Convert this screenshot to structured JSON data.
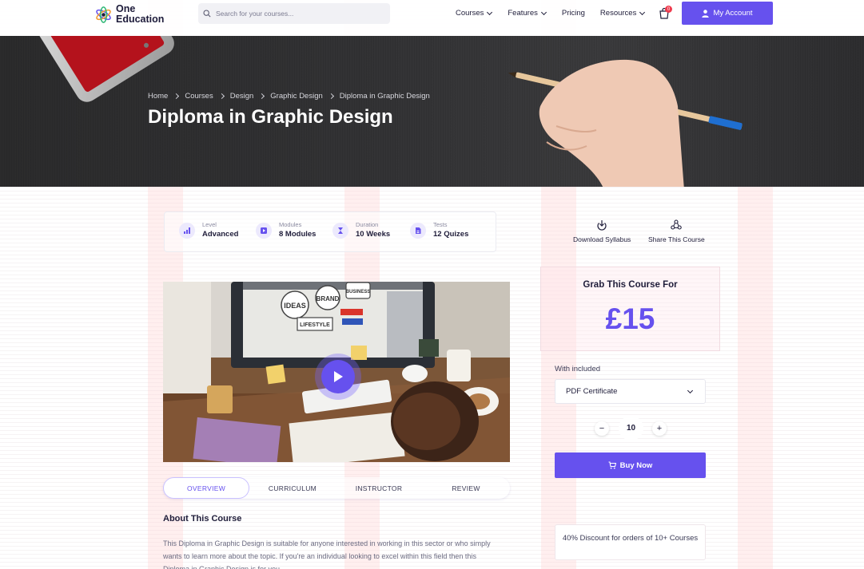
{
  "header": {
    "logo_line1": "One",
    "logo_line2": "Education",
    "search_placeholder": "Search for your courses...",
    "nav": [
      "Courses",
      "Features",
      "Pricing",
      "Resources"
    ],
    "cart_count": "0",
    "account_label": "My Account"
  },
  "hero": {
    "breadcrumb": [
      "Home",
      "Courses",
      "Design",
      "Graphic Design",
      "Diploma in Graphic Design"
    ],
    "title": "Diploma in Graphic Design"
  },
  "stats": [
    {
      "label": "Level",
      "value": "Advanced",
      "icon": "bar-chart-icon"
    },
    {
      "label": "Modules",
      "value": "8 Modules",
      "icon": "video-module-icon"
    },
    {
      "label": "Duration",
      "value": "10 Weeks",
      "icon": "hourglass-icon"
    },
    {
      "label": "Tests",
      "value": "12 Quizes",
      "icon": "document-quiz-icon"
    }
  ],
  "side_actions": {
    "download": "Download Syllabus",
    "share": "Share This Course"
  },
  "video": {
    "stickers": [
      "IDEAS",
      "BRAND",
      "BUSINESS",
      "LIFESTYLE"
    ]
  },
  "tabs": [
    "OVERVIEW",
    "CURRICULUM",
    "INSTRUCTOR",
    "REVIEW"
  ],
  "about": {
    "title": "About This Course",
    "text": "This Diploma in Graphic Design is suitable for anyone interested in working in this sector or who simply wants to learn more about the topic. If you're an individual looking to excel within this field then this Diploma in Graphic Design is for you."
  },
  "purchase": {
    "grab_label": "Grab This Course For",
    "price": "£15",
    "included_label": "With included",
    "selected_option": "PDF Certificate",
    "minus": "−",
    "plus": "+",
    "quantity": "10",
    "buy_label": "Buy Now",
    "discount": "40% Discount for orders of 10+ Courses"
  },
  "colors": {
    "accent": "#6651ee",
    "hero_bg": "#333335",
    "text_dark": "#1f1d3a",
    "badge": "#ef3b4e"
  }
}
